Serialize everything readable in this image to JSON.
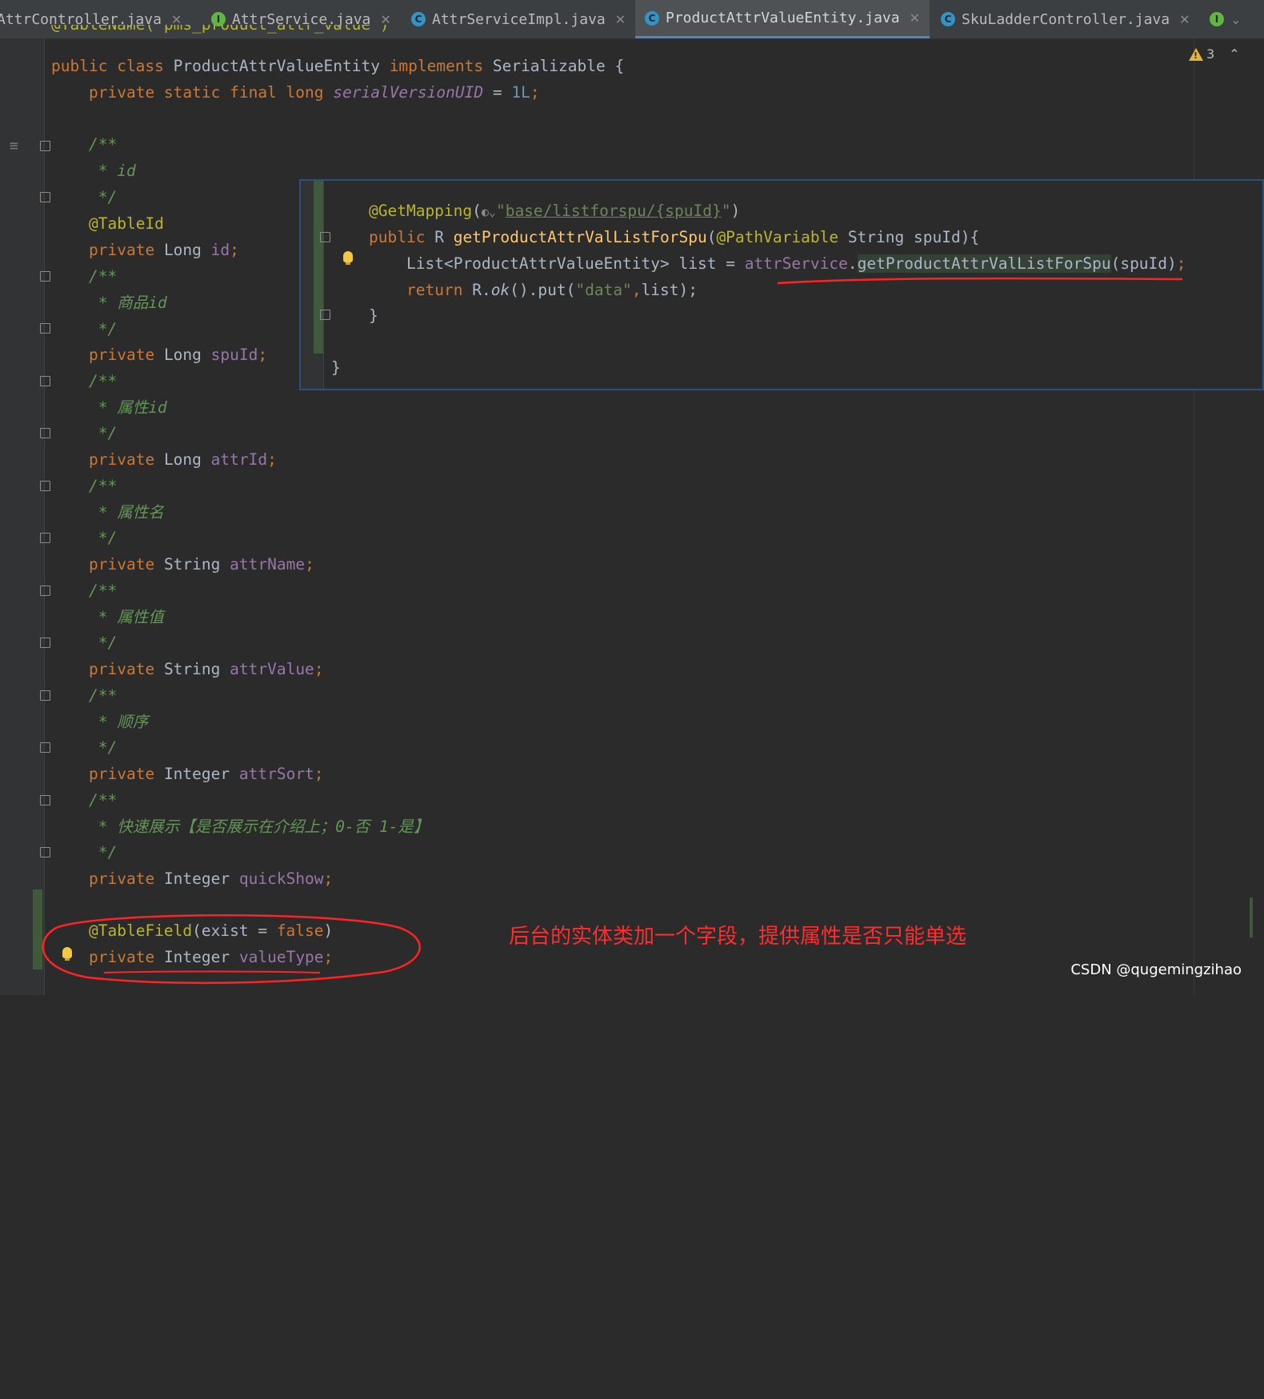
{
  "tabs": [
    {
      "label": "AttrController.java",
      "type": "C",
      "active": false
    },
    {
      "label": "AttrService.java",
      "type": "I",
      "active": false
    },
    {
      "label": "AttrServiceImpl.java",
      "type": "C",
      "active": false
    },
    {
      "label": "ProductAttrValueEntity.java",
      "type": "C",
      "active": true
    },
    {
      "label": "SkuLadderController.java",
      "type": "C",
      "active": false
    }
  ],
  "inspection": {
    "warning_count": "3"
  },
  "code": {
    "top_partial": "@TableName(\"pms_product_attr_value\")",
    "class_decl": {
      "kw1": "public",
      "kw2": "class",
      "name": "ProductAttrValueEntity",
      "kw3": "implements",
      "iface": "Serializable",
      "brace": "{"
    },
    "serial": {
      "mods": "private static final long",
      "name": "serialVersionUID",
      "eq": " = ",
      "val": "1L",
      "semi": ";"
    },
    "comments": {
      "open": "/**",
      "close": " */",
      "id": " * id",
      "spu": " * 商品id",
      "attr": " * 属性id",
      "attr_name": " * 属性名",
      "attr_value": " * 属性值",
      "sort": " * 顺序",
      "quick": " * 快速展示【是否展示在介绍上；0-否 1-是】"
    },
    "table_id": "@TableId",
    "fields": [
      {
        "type": "Long",
        "name": "id"
      },
      {
        "type": "Long",
        "name": "spuId"
      },
      {
        "type": "Long",
        "name": "attrId"
      },
      {
        "type": "String",
        "name": "attrName"
      },
      {
        "type": "String",
        "name": "attrValue"
      },
      {
        "type": "Integer",
        "name": "attrSort"
      },
      {
        "type": "Integer",
        "name": "quickShow"
      },
      {
        "type": "Integer",
        "name": "valueType"
      }
    ],
    "private_kw": "private",
    "table_field": {
      "annotation": "@TableField",
      "args_open": "(exist = ",
      "val": "false",
      "args_close": ")"
    }
  },
  "popup": {
    "mapping_annotation": "@GetMapping",
    "mapping_path": "base/listforspu/{spuId}",
    "method_mods": "public",
    "return_type": "R",
    "method_name": "getProductAttrValListForSpu",
    "param_annotation": "@PathVariable",
    "param_type": "String",
    "param_name": "spuId",
    "line3_type": "List<ProductAttrValueEntity>",
    "line3_var": "list",
    "line3_obj": "attrService",
    "line3_call": "getProductAttrValListForSpu",
    "line3_arg": "spuId",
    "line4_kw": "return",
    "line4_obj": "R.",
    "line4_ok": "ok",
    "line4_rest": "().put(",
    "line4_str": "\"data\"",
    "line4_tail": "list);",
    "close_inner": "}",
    "close_outer": "}"
  },
  "annotation_note": "后台的实体类加一个字段，提供属性是否只能单选",
  "watermark": "CSDN @qugemingzihao",
  "colors": {
    "annotation_red": "#ff2d2d",
    "accent_tab": "#4a88c7"
  }
}
